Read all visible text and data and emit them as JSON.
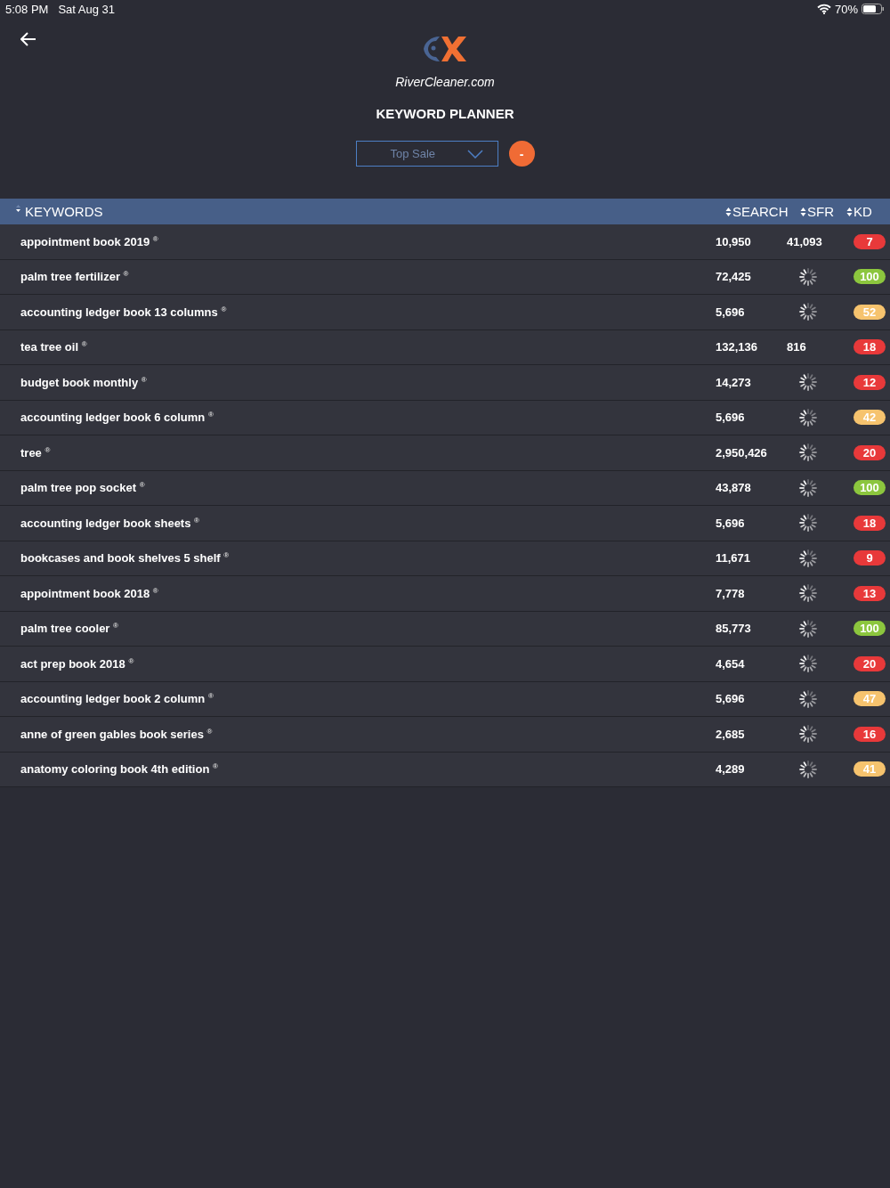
{
  "status_bar": {
    "time": "5:08 PM",
    "date": "Sat Aug 31",
    "battery": "70%"
  },
  "header": {
    "brand": "RiverCleaner.com",
    "title": "KEYWORD PLANNER"
  },
  "filter": {
    "value": "Top Sale",
    "button": "-"
  },
  "table": {
    "columns": [
      "KEYWORDS",
      "SEARCH",
      "SFR",
      "KD"
    ],
    "rows": [
      {
        "keyword": "appointment book 2019 $^{®}$",
        "search": "10,950",
        "kind": "value",
        "sfr": "41,093",
        "kd": "7",
        "color": "#e8393a"
      },
      {
        "keyword": "palm tree fertilizer $^{®}$",
        "search": "72,425",
        "kind": "loading",
        "kd": "100",
        "color": "#8cc63e"
      },
      {
        "keyword": "accounting ledger book 13 columns $^{®}$",
        "search": "5,696",
        "kind": "loading",
        "kd": "52",
        "color": "#f6c36e"
      },
      {
        "keyword": "tea tree oil $^{®}$",
        "search": "132,136",
        "kind": "value",
        "sfr": "816",
        "kd": "18",
        "color": "#e8393a"
      },
      {
        "keyword": "budget book monthly $^{®}$",
        "search": "14,273",
        "kind": "loading",
        "kd": "12",
        "color": "#e8393a"
      },
      {
        "keyword": "accounting ledger book 6 column $^{®}$",
        "search": "5,696",
        "kind": "loading",
        "kd": "42",
        "color": "#f6c36e"
      },
      {
        "keyword": "tree $^{®}$",
        "search": "2,950,426",
        "kind": "loading",
        "kd": "20",
        "color": "#e8393a"
      },
      {
        "keyword": "palm tree pop socket $^{®}$",
        "search": "43,878",
        "kind": "loading",
        "kd": "100",
        "color": "#8cc63e"
      },
      {
        "keyword": "accounting ledger book sheets $^{®}$",
        "search": "5,696",
        "kind": "loading",
        "kd": "18",
        "color": "#e8393a"
      },
      {
        "keyword": "bookcases and book shelves 5 shelf $^{®}$",
        "search": "11,671",
        "kind": "loading",
        "kd": "9",
        "color": "#e8393a"
      },
      {
        "keyword": "appointment book 2018 $^{®}$",
        "search": "7,778",
        "kind": "loading",
        "kd": "13",
        "color": "#e8393a"
      },
      {
        "keyword": "palm tree cooler $^{®}$",
        "search": "85,773",
        "kind": "loading",
        "kd": "100",
        "color": "#8cc63e"
      },
      {
        "keyword": "act prep book 2018 $^{®}$",
        "search": "4,654",
        "kind": "loading",
        "kd": "20",
        "color": "#e8393a"
      },
      {
        "keyword": "accounting ledger book 2 column $^{®}$",
        "search": "5,696",
        "kind": "loading",
        "kd": "47",
        "color": "#f6c36e"
      },
      {
        "keyword": "anne of green gables book series $^{®}$",
        "search": "2,685",
        "kind": "loading",
        "kd": "16",
        "color": "#e8393a"
      },
      {
        "keyword": "anatomy coloring book 4th edition $^{®}$",
        "search": "4,289",
        "kind": "loading",
        "kd": "41",
        "color": "#f6c36e"
      }
    ]
  }
}
